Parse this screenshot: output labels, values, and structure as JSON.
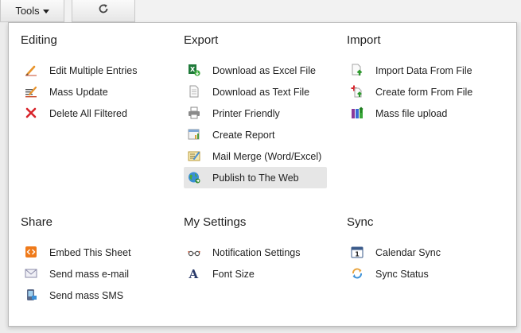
{
  "toolbar": {
    "tools_label": "Tools"
  },
  "menu": {
    "editing": {
      "title": "Editing",
      "items": [
        {
          "label": "Edit Multiple Entries",
          "icon": "pencil-icon"
        },
        {
          "label": "Mass Update",
          "icon": "mass-update-icon"
        },
        {
          "label": "Delete All Filtered",
          "icon": "delete-x-icon"
        }
      ]
    },
    "export": {
      "title": "Export",
      "items": [
        {
          "label": "Download as Excel File",
          "icon": "excel-download-icon"
        },
        {
          "label": "Download as Text File",
          "icon": "text-file-icon"
        },
        {
          "label": "Printer Friendly",
          "icon": "printer-icon"
        },
        {
          "label": "Create Report",
          "icon": "report-icon"
        },
        {
          "label": "Mail Merge (Word/Excel)",
          "icon": "mail-merge-icon"
        },
        {
          "label": "Publish to The Web",
          "icon": "globe-icon",
          "highlighted": true
        }
      ]
    },
    "import": {
      "title": "Import",
      "items": [
        {
          "label": "Import Data From File",
          "icon": "import-file-icon"
        },
        {
          "label": "Create form From File",
          "icon": "create-form-icon"
        },
        {
          "label": "Mass file upload",
          "icon": "mass-upload-icon"
        }
      ]
    },
    "share": {
      "title": "Share",
      "items": [
        {
          "label": "Embed This Sheet",
          "icon": "embed-code-icon"
        },
        {
          "label": "Send mass e-mail",
          "icon": "envelope-icon"
        },
        {
          "label": "Send mass SMS",
          "icon": "phone-sms-icon"
        }
      ]
    },
    "my_settings": {
      "title": "My Settings",
      "items": [
        {
          "label": "Notification Settings",
          "icon": "glasses-icon"
        },
        {
          "label": "Font Size",
          "icon": "font-size-icon"
        }
      ]
    },
    "sync": {
      "title": "Sync",
      "items": [
        {
          "label": "Calendar Sync",
          "icon": "calendar-icon"
        },
        {
          "label": "Sync Status",
          "icon": "sync-icon"
        }
      ]
    }
  }
}
